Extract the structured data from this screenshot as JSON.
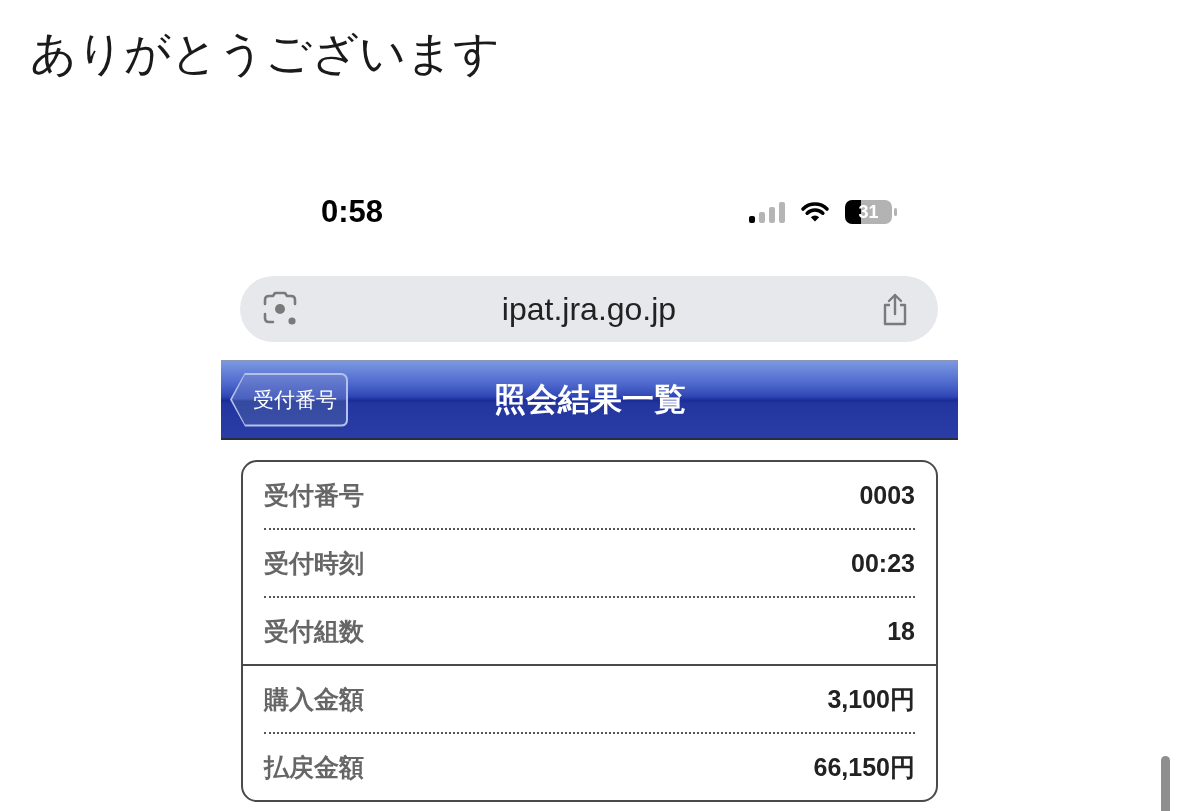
{
  "heading": "ありがとうございます",
  "status_bar": {
    "time": "0:58",
    "battery_percent": "31"
  },
  "address_bar": {
    "url": "ipat.jra.go.jp"
  },
  "nav_bar": {
    "back_button": "受付番号",
    "title": "照会結果一覧"
  },
  "summary": {
    "groups": [
      {
        "rows": [
          {
            "label": "受付番号",
            "value": "0003"
          },
          {
            "label": "受付時刻",
            "value": "00:23"
          },
          {
            "label": "受付組数",
            "value": "18"
          }
        ]
      },
      {
        "rows": [
          {
            "label": "購入金額",
            "value": "3,100円"
          },
          {
            "label": "払戻金額",
            "value": "66,150円"
          }
        ]
      }
    ]
  }
}
